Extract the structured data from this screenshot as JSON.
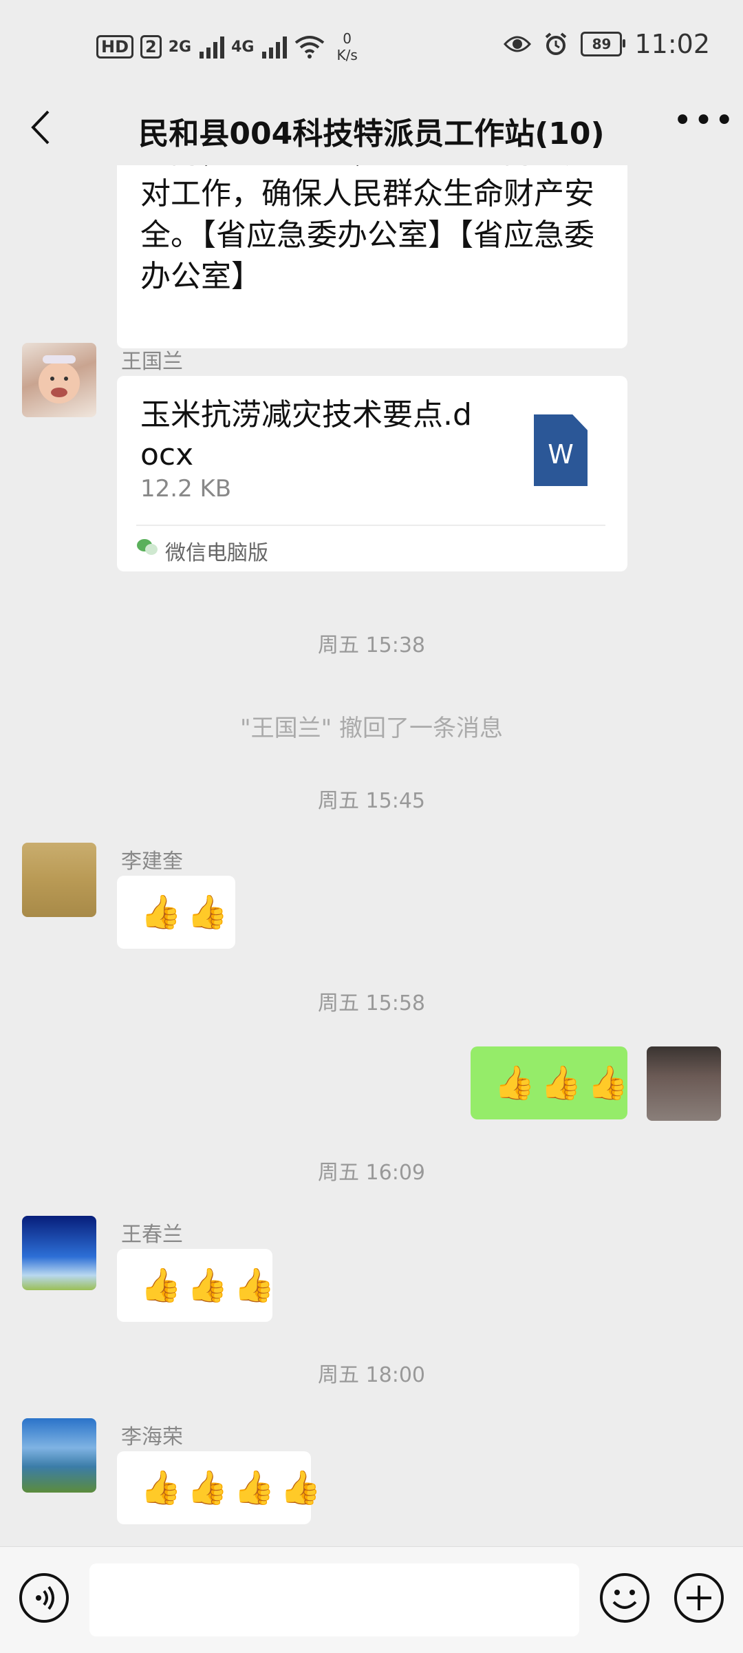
{
  "status_bar": {
    "hd": "HD",
    "sim": "2",
    "sig1": "2G",
    "sig2": "4G",
    "speed_value": "0",
    "speed_unit": "K/s",
    "battery": "89",
    "time": "11:02"
  },
  "header": {
    "title": "民和县004科技特派员工作站(10)"
  },
  "messages": {
    "notice_text": "预防，压实责任，切实做好防范应对工作，确保人民群众生命财产安全。【省应急委办公室】【省应急委办公室】",
    "file_sender": "王国兰",
    "file_name": "玉米抗涝减灾技术要点.docx",
    "file_size": "12.2 KB",
    "file_icon_letter": "W",
    "file_source": "微信电脑版",
    "time1": "周五 15:38",
    "recall_notice": "\"王国兰\" 撤回了一条消息",
    "time2": "周五 15:45",
    "sender2": "李建奎",
    "time3": "周五 15:58",
    "time4": "周五 16:09",
    "sender4": "王春兰",
    "time5": "周五 18:00",
    "sender5": "李海荣"
  },
  "colors": {
    "bg": "#ededed",
    "bubble_white": "#ffffff",
    "bubble_green": "#95ec69",
    "word_blue": "#2b5797"
  },
  "icons": {
    "back": "back-arrow-icon",
    "more": "more-icon",
    "voice": "voice-icon",
    "emoji": "emoji-icon",
    "plus": "plus-icon",
    "thumbs": "thumbs-up-emoji"
  }
}
